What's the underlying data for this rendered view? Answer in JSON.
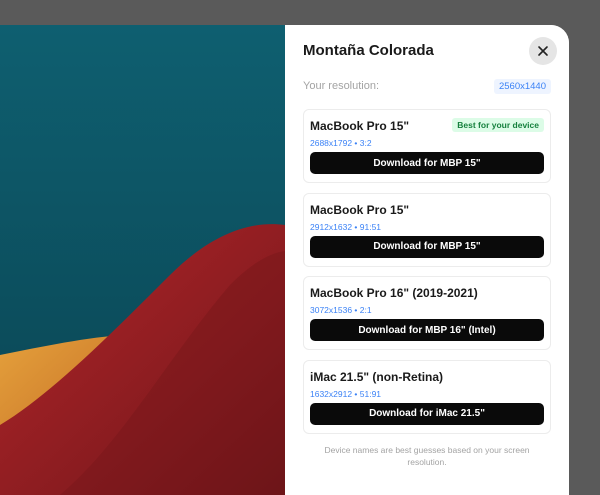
{
  "panel": {
    "title": "Montaña Colorada",
    "resolution_label": "Your resolution:",
    "resolution_value": "2560x1440",
    "footnote": "Device names are best guesses based on your screen resolution."
  },
  "close_icon": "close-icon",
  "devices": [
    {
      "name": "MacBook Pro 15\"",
      "specs": "2688x1792 • 3:2",
      "badge": "Best for your device",
      "button": "Download for MBP 15\""
    },
    {
      "name": "MacBook Pro 15\"",
      "specs": "2912x1632 • 91:51",
      "button": "Download for MBP 15\""
    },
    {
      "name": "MacBook Pro 16\" (2019-2021)",
      "specs": "3072x1536 • 2:1",
      "button": "Download for MBP 16\" (Intel)"
    },
    {
      "name": "iMac 21.5\" (non-Retina)",
      "specs": "1632x2912 • 51:91",
      "button": "Download for iMac 21.5\""
    }
  ],
  "colors": {
    "accent": "#3b82f6",
    "badge_bg": "#dcfce7",
    "badge_text": "#15803d",
    "button_bg": "#0a0a0a"
  }
}
